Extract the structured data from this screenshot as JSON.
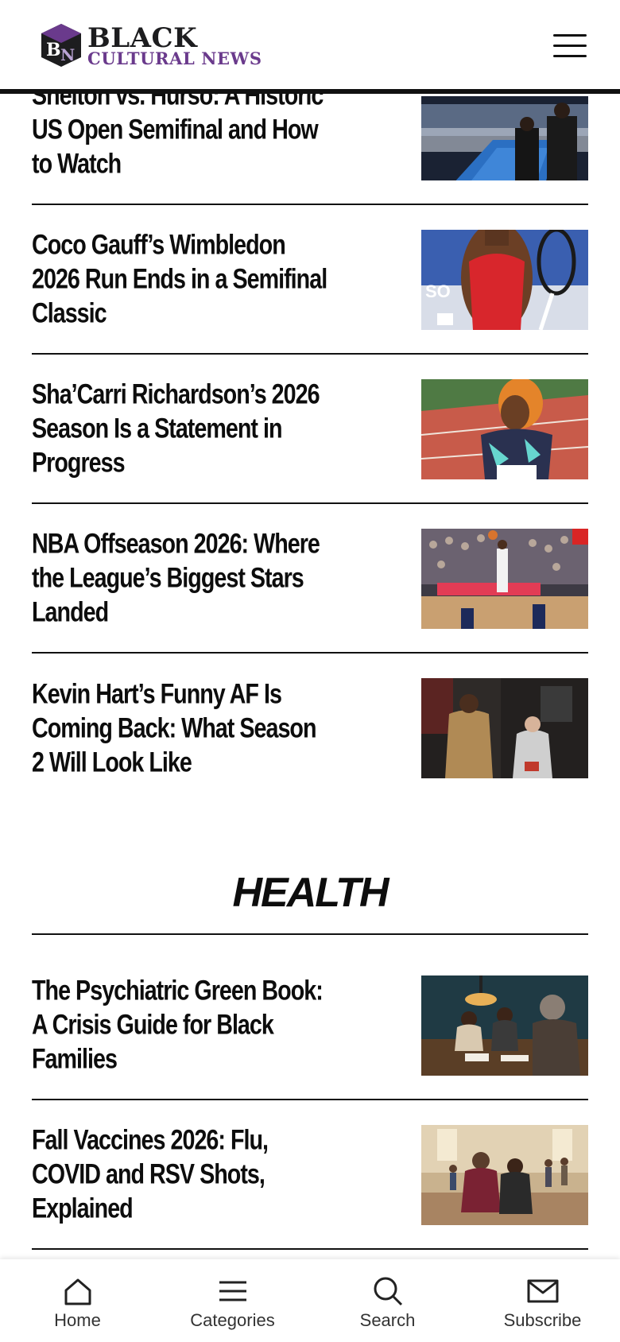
{
  "brand": {
    "line1": "BLACK",
    "line2": "CULTURAL NEWS",
    "colors": {
      "primary": "#1d1d1f",
      "accent": "#6a3a8c"
    }
  },
  "sports_articles": [
    {
      "title": "Shelton vs. Hurso: A Historic US Open Semifinal and How to Watch",
      "image": "tennis-stadium-photo"
    },
    {
      "title": "Coco Gauff’s Wimbledon 2026 Run Ends in a Semifinal Classic",
      "image": "tennis-player-photo"
    },
    {
      "title": "Sha’Carri Richardson’s 2026 Season Is a Statement in Progress",
      "image": "sprinter-photo"
    },
    {
      "title": "NBA Offseason 2026: Where the League’s Biggest Stars Landed",
      "image": "basketball-game-photo"
    },
    {
      "title": "Kevin Hart’s Funny AF Is Coming Back: What Season 2 Will Look Like",
      "image": "red-carpet-photo"
    }
  ],
  "health_section": {
    "heading": "HEALTH",
    "articles": [
      {
        "title": "The Psychiatric Green Book: A Crisis Guide for Black Families",
        "image": "family-table-photo"
      },
      {
        "title": "Fall Vaccines 2026: Flu, COVID and RSV Shots, Explained",
        "image": "clinic-waiting-photo"
      }
    ]
  },
  "bottom_nav": [
    {
      "label": "Home",
      "icon": "home-icon"
    },
    {
      "label": "Categories",
      "icon": "menu-icon"
    },
    {
      "label": "Search",
      "icon": "search-icon"
    },
    {
      "label": "Subscribe",
      "icon": "mail-icon"
    }
  ]
}
